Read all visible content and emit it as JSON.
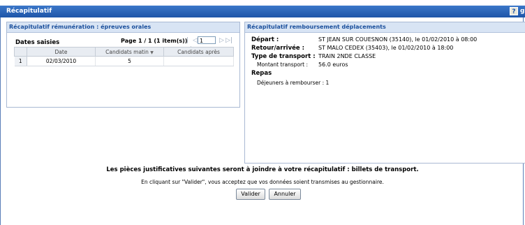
{
  "window": {
    "title": "Récapitulatif",
    "help_icon": "?",
    "extra": "g"
  },
  "left_panel": {
    "title": "Récapitulatif rémunération : épreuves orales",
    "dates_title": "Dates saisies",
    "pager": {
      "text": "Page 1 / 1 (1 item(s))",
      "page_value": "1"
    },
    "columns": [
      "Date",
      "Candidats matin",
      "Candidats après"
    ],
    "sort_icon": "sort-down-icon",
    "rows": [
      {
        "num": "1",
        "date": "02/03/2010",
        "matin": "5",
        "apres": ""
      }
    ]
  },
  "right_panel": {
    "title": "Récapitulatif remboursement déplacements",
    "depart_label": "Départ :",
    "depart_value": "ST JEAN SUR COUESNON (35140), le 01/02/2010 à 08:00",
    "retour_label": "Retour/arrivée :",
    "retour_value": "ST MALO CEDEX (35403), le 01/02/2010 à 18:00",
    "transport_label": "Type de transport :",
    "transport_value": "TRAIN 2NDE CLASSE",
    "montant_label": "Montant transport :",
    "montant_value": "56.0 euros",
    "repas_label": "Repas",
    "dejeuners_label": "Déjeuners à rembourser : 1"
  },
  "notice": {
    "line1": "Les pièces justificatives suivantes seront à joindre à votre récapitulatif : billets de transport.",
    "line2": "En cliquant sur \"Valider\", vous acceptez que vos données soient transmises au gestionnaire."
  },
  "buttons": {
    "valider": "Valider",
    "annuler": "Annuler"
  }
}
